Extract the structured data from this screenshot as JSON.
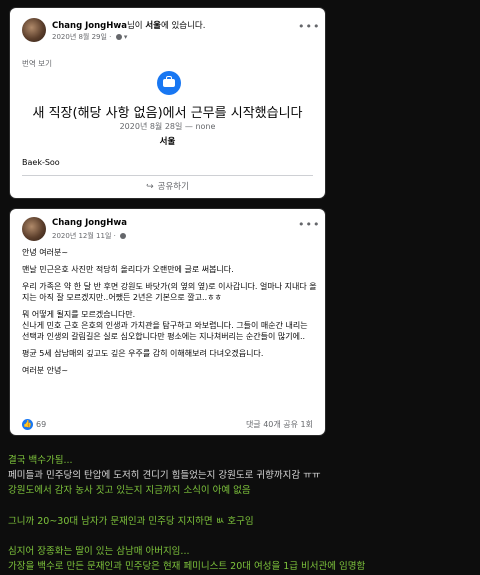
{
  "post1": {
    "author": "Chang JongHwa",
    "checkin_suffix": "님이",
    "checkin_place": "서울",
    "checkin_tail": "에 있습니다.",
    "date": "2020년 8월 29일",
    "translate_label": "번역 보기",
    "life_event_icon": "briefcase-icon",
    "headline": "새 직장(해당 사항 없음)에서 근무를 시작했습니다",
    "date_range": "2020년 8월 28일 — none",
    "location": "서울",
    "body": "Baek-Soo",
    "share_label": "공유하기"
  },
  "post2": {
    "author": "Chang JongHwa",
    "date": "2020년 12월 11일",
    "paragraphs": [
      "안녕 여러분~",
      "맨날 민근은호 사진만 적당히 올리다가 오랜만에 글로 써봅니다.",
      "우리 가족은 약 한 달 반 후면 강원도 바닷가(의 옆의 옆)로 이사갑니다. 얼마나 지내다 올 지는 아직 잘 모르겠지만..어쨌든 2년은 기본으로 깔고..ㅎㅎ",
      "뭐 어떻게 될지를 모르겠습니다만.",
      "신나게 민호 근호 은호의 인생과 가치관을 탐구하고 와보렵니다. 그들이 매순간 내리는 선택과 인생의 갈림길은 실로 심오합니다만 평소에는 지나쳐버리는 순간들이 많기에..",
      "평균 5세 삼남매의 깊고도 깊은 우주를 감히 이해해보려 다녀오겠읍니다.",
      "여러분 안녕~"
    ],
    "reaction_count": "69",
    "comments_shares": "댓글 40개  공유 1회"
  },
  "captions": [
    {
      "text": "결국 백수가됨...",
      "color": "green"
    },
    {
      "text": "페미들과 민주당의 탄압에 도저히 견디기 힘들었는지 강원도로 귀향까지감 ㅠㅠ",
      "color": "white"
    },
    {
      "text": "강원도에서 감자 농사 짓고 있는지 지금까지 소식이 아예 없음",
      "color": "green"
    },
    {
      "text": "그니까 20~30대 남자가 문재인과 민주당 지지하면 ㅄ 호구임",
      "color": "green"
    },
    {
      "text": "심지어 장종화는 딸이 있는 삼남매 아버지임...",
      "color": "green"
    },
    {
      "text": "가장을 백수로 만든 문재인과 민주당은 현재 페미니스트 20대 여성을 1급 비서관에 임명함",
      "color": "green"
    }
  ],
  "colors": {
    "facebook_blue": "#1877f2",
    "caption_green": "#7ec43c",
    "background": "#0d0d0d"
  }
}
